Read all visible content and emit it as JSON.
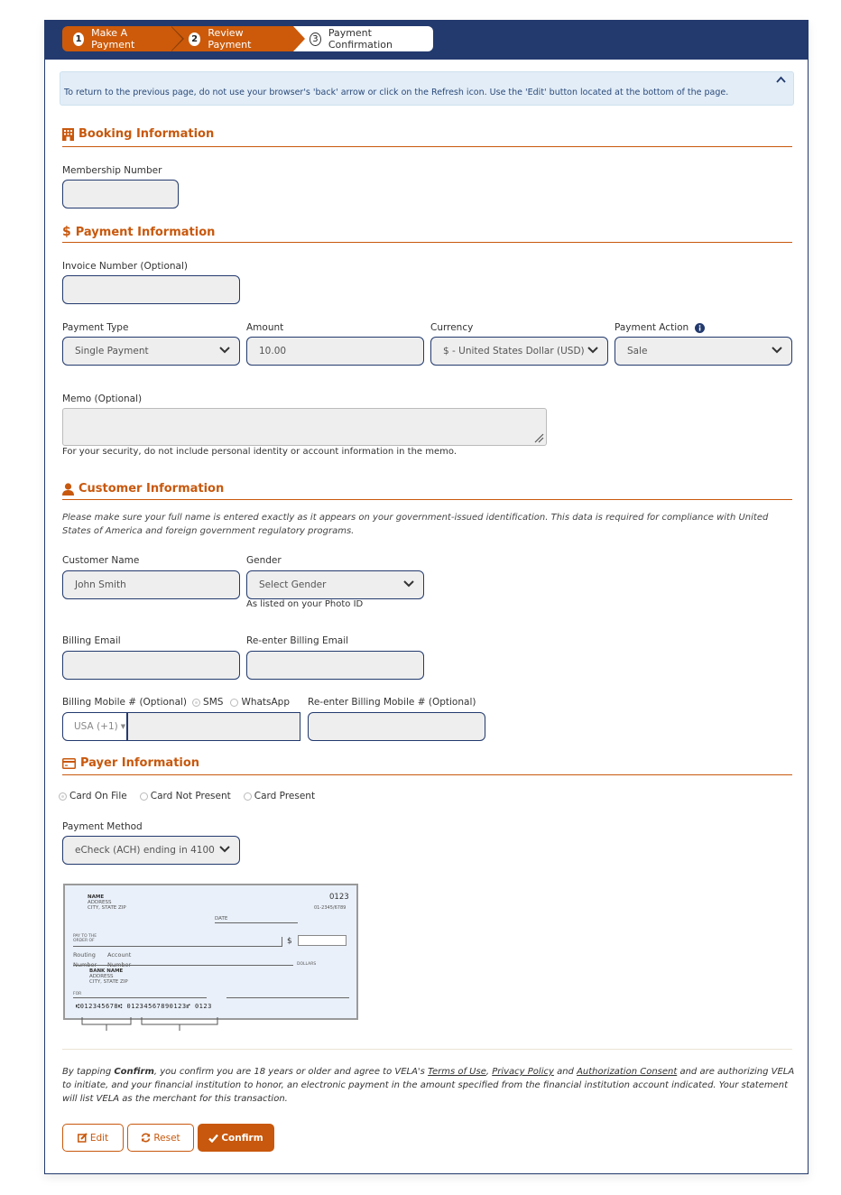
{
  "steps": [
    {
      "num": "1",
      "label": "Make A Payment"
    },
    {
      "num": "2",
      "label": "Review Payment"
    },
    {
      "num": "3",
      "label": "Payment Confirmation"
    }
  ],
  "notice": {
    "text": "To return to the previous page, do not use your browser's 'back' arrow or click on the Refresh icon. Use the 'Edit' button located at the bottom of the page.",
    "collapse_icon": "chevron-up-icon"
  },
  "booking": {
    "title": "Booking Information",
    "icon": "building-icon",
    "membership_label": "Membership Number",
    "membership_value": ""
  },
  "payment": {
    "title": "Payment Information",
    "icon": "dollar-icon",
    "invoice_label": "Invoice Number (Optional)",
    "invoice_value": "",
    "type_label": "Payment Type",
    "type_value": "Single Payment",
    "amount_label": "Amount",
    "amount_value": "10.00",
    "currency_label": "Currency",
    "currency_value": "$ - United States Dollar (USD)",
    "action_label": "Payment Action",
    "action_value": "Sale",
    "memo_label": "Memo (Optional)",
    "memo_value": "",
    "memo_help": "For your security, do not include personal identity or account information in the memo."
  },
  "customer": {
    "title": "Customer Information",
    "icon": "user-icon",
    "notice": "Please make sure your full name is entered exactly as it appears on your government-issued identification. This data is required for compliance with United States of America and foreign government regulatory programs.",
    "name_label": "Customer Name",
    "name_value": "John Smith",
    "gender_label": "Gender",
    "gender_value": "Select Gender",
    "gender_help": "As listed on your Photo ID",
    "email_label": "Billing Email",
    "email_value": "",
    "email2_label": "Re-enter Billing Email",
    "email2_value": "",
    "mobile_label": "Billing Mobile # (Optional)",
    "mobile_options": [
      "SMS",
      "WhatsApp"
    ],
    "mobile_selected": "SMS",
    "country_code": "USA (+1)",
    "mobile_value": "",
    "mobile2_label": "Re-enter Billing Mobile # (Optional)",
    "mobile2_value": ""
  },
  "payer": {
    "title": "Payer Information",
    "icon": "credit-card-icon",
    "card_options": [
      "Card On File",
      "Card Not Present",
      "Card Present"
    ],
    "card_selected": "Card On File",
    "method_label": "Payment Method",
    "method_value": "eCheck (ACH) ending in 4100"
  },
  "check_image": {
    "name": "NAME",
    "address": "ADDRESS",
    "city": "CITY, STATE  ZIP",
    "number": "0123",
    "fraction": "01-2345/6789",
    "date": "DATE",
    "pay_to_1": "PAY TO THE",
    "pay_to_2": "ORDER OF",
    "dollar_sign": "$",
    "routing_label_1": "Routing",
    "routing_label_2": "Number",
    "account_label_1": "Account",
    "account_label_2": "Number",
    "dollars": "DOLLARS",
    "bank_name": "BANK NAME",
    "bank_address": "ADDRESS",
    "bank_city": "CITY, STATE  ZIP",
    "for": "FOR",
    "micr": "⑆012345678⑆ 01234567890123⑈ 0123"
  },
  "legal": {
    "prefix": "By tapping ",
    "confirm_word": "Confirm",
    "part1": ", you confirm you are 18 years or older and agree to VELA's ",
    "terms": "Terms of Use",
    "comma": ", ",
    "privacy": "Privacy Policy",
    "and": " and ",
    "consent": "Authorization Consent",
    "part2": " and are authorizing VELA to initiate, and your financial institution to honor, an electronic payment in the amount specified from the financial institution account indicated. Your statement will list VELA as the merchant for this transaction."
  },
  "buttons": {
    "edit": "Edit",
    "reset": "Reset",
    "confirm": "Confirm"
  },
  "colors": {
    "brand_navy": "#233a6e",
    "accent_orange": "#cc5a0a",
    "notice_bg": "#e2edf7",
    "input_bg": "#eeeeee"
  }
}
